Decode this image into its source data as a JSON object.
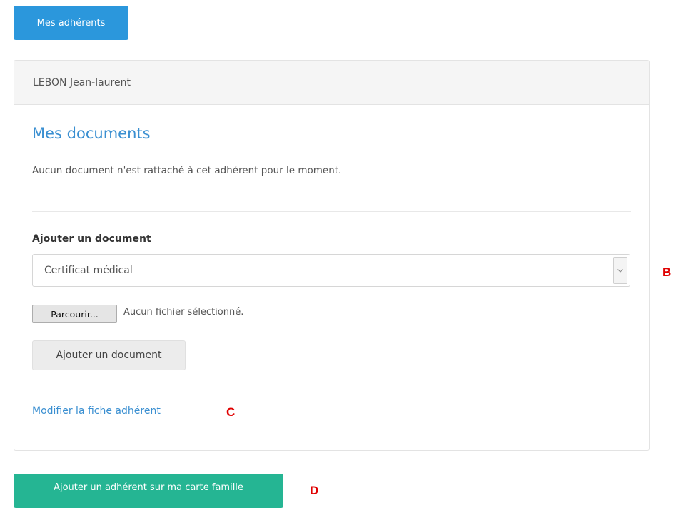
{
  "top_button": {
    "label": "Mes adhérents"
  },
  "member_panel": {
    "member_name": "LEBON Jean-laurent",
    "documents_title": "Mes documents",
    "no_documents_text": "Aucun document n'est rattaché à cet adhérent pour le moment.",
    "add_document_label": "Ajouter un document",
    "document_type_select": {
      "selected": "Certificat médical"
    },
    "file_browse_button": "Parcourir...",
    "file_status": "Aucun fichier sélectionné.",
    "add_document_button": "Ajouter un document",
    "edit_member_link": "Modifier la fiche adhérent"
  },
  "bottom_button": {
    "label": "Ajouter un adhérent sur ma carte famille"
  },
  "annotation_markers": {
    "b": "B",
    "c": "C",
    "d": "D"
  },
  "colors": {
    "primary_blue": "#2b97dc",
    "link_blue": "#3a8fd1",
    "success_green": "#25b593",
    "marker_red": "#e00000"
  },
  "icons": {
    "select_arrow": "chevron-down-icon"
  }
}
